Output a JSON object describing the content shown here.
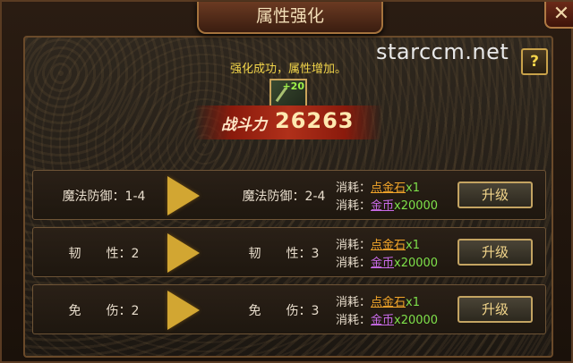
{
  "window": {
    "title": "属性强化",
    "close_symbol": "✕"
  },
  "watermark": "starccm.net",
  "help": "?",
  "message": "强化成功，属性增加。",
  "item": {
    "level": "+20"
  },
  "power": {
    "label": "战斗力",
    "value": "26263"
  },
  "rows": [
    {
      "before": "魔法防御：1-4",
      "after": "魔法防御：2-4",
      "cost_label1": "消耗：",
      "cost_item1": "点金石",
      "cost_qty1": "x1",
      "cost_label2": "消耗：",
      "cost_item2": "金币",
      "cost_qty2": "x20000",
      "button": "升级"
    },
    {
      "before": "韧　　性：2",
      "after": "韧　　性：3",
      "cost_label1": "消耗：",
      "cost_item1": "点金石",
      "cost_qty1": "x1",
      "cost_label2": "消耗：",
      "cost_item2": "金币",
      "cost_qty2": "x20000",
      "button": "升级"
    },
    {
      "before": "免　　伤：2",
      "after": "免　　伤：3",
      "cost_label1": "消耗：",
      "cost_item1": "点金石",
      "cost_qty1": "x1",
      "cost_label2": "消耗：",
      "cost_item2": "金币",
      "cost_qty2": "x20000",
      "button": "升级"
    }
  ],
  "colors": {
    "accent": "#f2d54a",
    "stone": "#f2a52a",
    "gold": "#c86ae6",
    "qty": "#7ee04a"
  }
}
